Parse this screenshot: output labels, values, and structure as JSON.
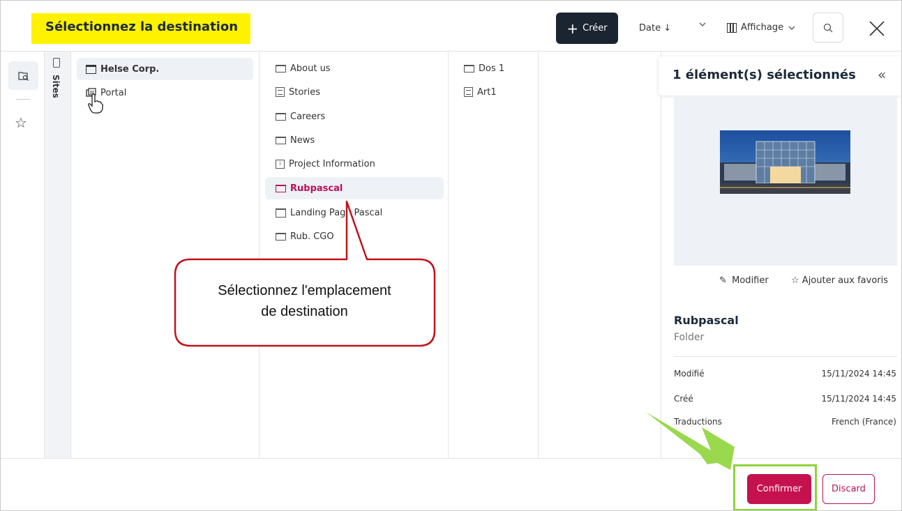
{
  "header": {
    "title": "Sélectionnez la destination",
    "create_label": "Créer",
    "sort_label": "Date ↓",
    "view_label": "Affichage"
  },
  "rail": {
    "sites_label": "Sites"
  },
  "columns": {
    "col1": [
      {
        "label": "Helse Corp.",
        "icon": "site-icon",
        "selected": true
      },
      {
        "label": "Portal",
        "icon": "portal-icon",
        "selected": false
      }
    ],
    "col2": [
      {
        "label": "About us",
        "icon": "folder-icon"
      },
      {
        "label": "Stories",
        "icon": "page-icon"
      },
      {
        "label": "Careers",
        "icon": "folder-icon"
      },
      {
        "label": "News",
        "icon": "folder-icon"
      },
      {
        "label": "Project Information",
        "icon": "info-icon"
      },
      {
        "label": "Rubpascal",
        "icon": "folder-icon",
        "selected": true
      },
      {
        "label": "Landing Page Pascal",
        "icon": "site-icon"
      },
      {
        "label": "Rub. CGO",
        "icon": "folder-icon"
      }
    ],
    "col3": [
      {
        "label": "Dos 1",
        "icon": "folder-icon"
      },
      {
        "label": "Art1",
        "icon": "page-icon"
      }
    ]
  },
  "panel": {
    "title": "1 élément(s) sélectionnés",
    "edit_label": "Modifier",
    "favorite_label": "Ajouter aux favoris",
    "name": "Rubpascal",
    "type": "Folder",
    "meta": [
      {
        "key": "Modifié",
        "value": "15/11/2024 14:45"
      },
      {
        "key": "Créé",
        "value": "15/11/2024 14:45"
      },
      {
        "key": "Traductions",
        "value": "French (France)"
      }
    ]
  },
  "footer": {
    "confirm_label": "Confirmer",
    "discard_label": "Discard"
  },
  "callout": {
    "text_line1": "Sélectionnez l'emplacement",
    "text_line2": "de destination"
  },
  "colors": {
    "accent": "#c5124e",
    "dark": "#1b2431",
    "highlight_yellow": "#fff200",
    "highlight_green": "#8fd43a",
    "callout_border": "#c0121b"
  }
}
